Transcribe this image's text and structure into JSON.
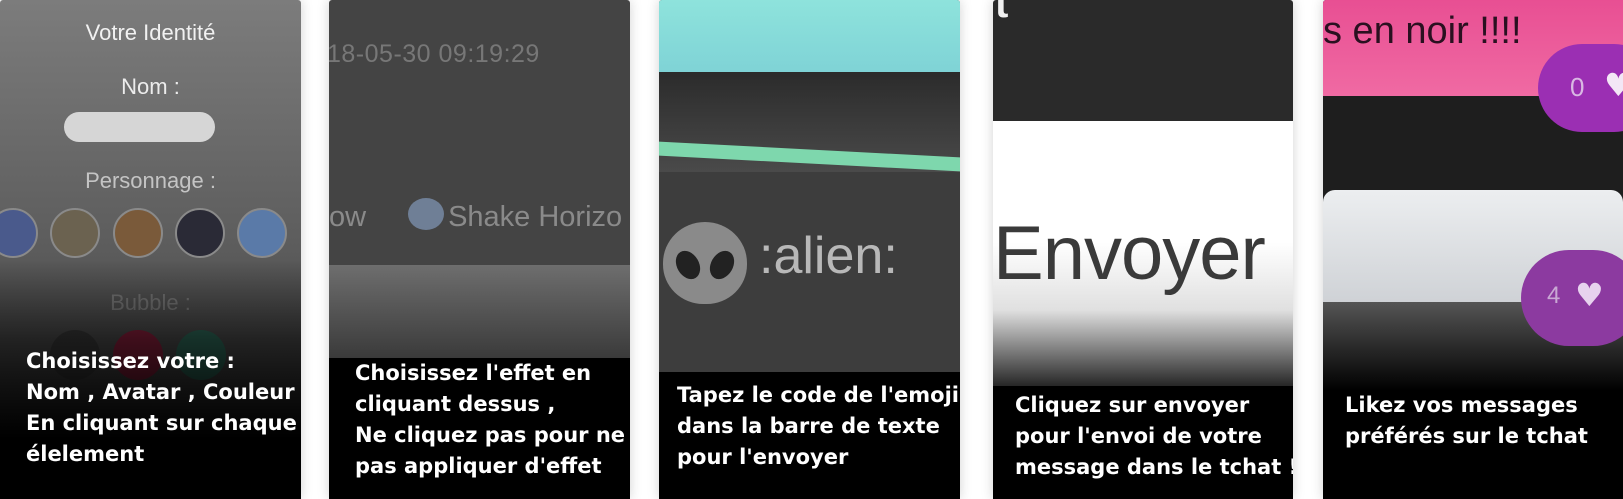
{
  "cards": [
    {
      "identity_title": "Votre Identité",
      "name_label": "Nom :",
      "character_label": "Personnage :",
      "bubble_label": "Bubble :",
      "avatar_colors": [
        "#4a5a8c",
        "#6b6250",
        "#7a5a3a",
        "#2a2a36",
        "#5a7aa8"
      ],
      "bubble_colors": [
        "#3a3a3a",
        "#8a1f3c",
        "#2f6b5a"
      ],
      "caption": [
        "Choisissez votre :",
        "Nom , Avatar , Couleur",
        "En cliquant sur chaque",
        "élelement"
      ]
    },
    {
      "timestamp": "18-05-30 09:19:29",
      "effect_left": "ow",
      "effect_right": "Shake Horizo",
      "caption": [
        "Choisissez l'effet en",
        "cliquant dessus ,",
        "Ne cliquez pas pour ne",
        "pas appliquer d'effet"
      ]
    },
    {
      "emoji_code": ":alien:",
      "caption": [
        "Tapez le code de l'emoji",
        "dans la barre de texte",
        "pour l'envoyer"
      ]
    },
    {
      "top_glyph": "t",
      "send_label": "Envoyer",
      "caption": [
        "Cliquez sur envoyer",
        "pour l'envoi de votre",
        "message dans le tchat !"
      ]
    },
    {
      "message_text": "s en noir !!!!",
      "likes_1": "0",
      "likes_2": "4",
      "caption": [
        "Likez vos messages",
        "préférés sur le tchat"
      ]
    }
  ],
  "colors": {
    "accent_pink": "#e84f93",
    "like_purple": "#9b2fb3",
    "teal": "#7fd3d6",
    "mint": "#7ed7ad"
  }
}
